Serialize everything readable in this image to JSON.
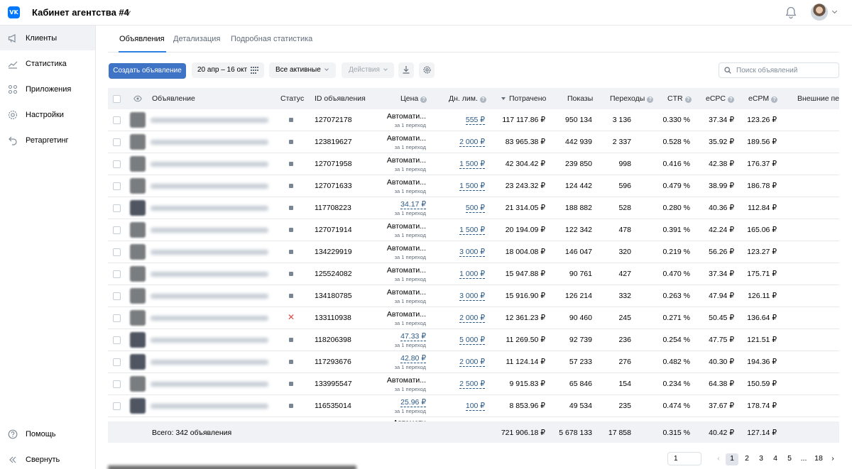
{
  "header": {
    "logo_text": "VK",
    "cabinet_title": "Кабинет агентства #4"
  },
  "sidebar": {
    "items": [
      {
        "label": "Клиенты",
        "icon": "megaphone-icon"
      },
      {
        "label": "Статистика",
        "icon": "chart-line-icon"
      },
      {
        "label": "Приложения",
        "icon": "apps-grid-icon"
      },
      {
        "label": "Настройки",
        "icon": "gear-icon"
      },
      {
        "label": "Ретаргетинг",
        "icon": "retarget-icon"
      }
    ],
    "help": "Помощь",
    "collapse": "Свернуть"
  },
  "tabs": [
    {
      "label": "Объявления",
      "active": true
    },
    {
      "label": "Детализация",
      "active": false
    },
    {
      "label": "Подробная статистика",
      "active": false
    }
  ],
  "toolbar": {
    "create": "Создать объявление",
    "date_range": "20 апр – 16 окт",
    "filter": "Все активные",
    "actions": "Действия",
    "search_placeholder": "Поиск объявлений"
  },
  "table": {
    "columns": {
      "ad": "Объявление",
      "status": "Статус",
      "id": "ID объявления",
      "price": "Цена",
      "limit": "Дн. лим.",
      "spent": "Потрачено",
      "impressions": "Показы",
      "clicks": "Переходы",
      "ctr": "CTR",
      "ecpc": "eCPC",
      "ecpm": "eCPM",
      "external": "Внешние пер"
    },
    "per_click": "за 1 переход",
    "rows": [
      {
        "status": "active",
        "id": "127072178",
        "price": "Автомати...",
        "price_auto": true,
        "limit": "555 ₽",
        "spent": "117 117.86 ₽",
        "impressions": "950 134",
        "clicks": "3 136",
        "ctr": "0.330 %",
        "ecpc": "37.34 ₽",
        "ecpm": "123.26 ₽"
      },
      {
        "status": "active",
        "id": "123819627",
        "price": "Автомати...",
        "price_auto": true,
        "limit": "2 000 ₽",
        "spent": "83 965.38 ₽",
        "impressions": "442 939",
        "clicks": "2 337",
        "ctr": "0.528 %",
        "ecpc": "35.92 ₽",
        "ecpm": "189.56 ₽"
      },
      {
        "status": "active",
        "id": "127071958",
        "price": "Автомати...",
        "price_auto": true,
        "limit": "1 500 ₽",
        "spent": "42 304.42 ₽",
        "impressions": "239 850",
        "clicks": "998",
        "ctr": "0.416 %",
        "ecpc": "42.38 ₽",
        "ecpm": "176.37 ₽"
      },
      {
        "status": "active",
        "id": "127071633",
        "price": "Автомати...",
        "price_auto": true,
        "limit": "1 500 ₽",
        "spent": "23 243.32 ₽",
        "impressions": "124 442",
        "clicks": "596",
        "ctr": "0.479 %",
        "ecpc": "38.99 ₽",
        "ecpm": "186.78 ₽"
      },
      {
        "status": "active",
        "id": "117708223",
        "price": "34.17 ₽",
        "price_auto": false,
        "limit": "500 ₽",
        "spent": "21 314.05 ₽",
        "impressions": "188 882",
        "clicks": "528",
        "ctr": "0.280 %",
        "ecpc": "40.36 ₽",
        "ecpm": "112.84 ₽"
      },
      {
        "status": "active",
        "id": "127071914",
        "price": "Автомати...",
        "price_auto": true,
        "limit": "1 500 ₽",
        "spent": "20 194.09 ₽",
        "impressions": "122 342",
        "clicks": "478",
        "ctr": "0.391 %",
        "ecpc": "42.24 ₽",
        "ecpm": "165.06 ₽"
      },
      {
        "status": "active",
        "id": "134229919",
        "price": "Автомати...",
        "price_auto": true,
        "limit": "3 000 ₽",
        "spent": "18 004.08 ₽",
        "impressions": "146 047",
        "clicks": "320",
        "ctr": "0.219 %",
        "ecpc": "56.26 ₽",
        "ecpm": "123.27 ₽"
      },
      {
        "status": "active",
        "id": "125524082",
        "price": "Автомати...",
        "price_auto": true,
        "limit": "1 000 ₽",
        "spent": "15 947.88 ₽",
        "impressions": "90 761",
        "clicks": "427",
        "ctr": "0.470 %",
        "ecpc": "37.34 ₽",
        "ecpm": "175.71 ₽"
      },
      {
        "status": "active",
        "id": "134180785",
        "price": "Автомати...",
        "price_auto": true,
        "limit": "3 000 ₽",
        "spent": "15 916.90 ₽",
        "impressions": "126 214",
        "clicks": "332",
        "ctr": "0.263 %",
        "ecpc": "47.94 ₽",
        "ecpm": "126.11 ₽"
      },
      {
        "status": "rejected",
        "id": "133110938",
        "price": "Автомати...",
        "price_auto": true,
        "limit": "2 000 ₽",
        "spent": "12 361.23 ₽",
        "impressions": "90 460",
        "clicks": "245",
        "ctr": "0.271 %",
        "ecpc": "50.45 ₽",
        "ecpm": "136.64 ₽"
      },
      {
        "status": "active",
        "id": "118206398",
        "price": "47.33 ₽",
        "price_auto": false,
        "limit": "5 000 ₽",
        "spent": "11 269.50 ₽",
        "impressions": "92 739",
        "clicks": "236",
        "ctr": "0.254 %",
        "ecpc": "47.75 ₽",
        "ecpm": "121.51 ₽"
      },
      {
        "status": "active",
        "id": "117293676",
        "price": "42.80 ₽",
        "price_auto": false,
        "limit": "2 000 ₽",
        "spent": "11 124.14 ₽",
        "impressions": "57 233",
        "clicks": "276",
        "ctr": "0.482 %",
        "ecpc": "40.30 ₽",
        "ecpm": "194.36 ₽"
      },
      {
        "status": "active",
        "id": "133995547",
        "price": "Автомати...",
        "price_auto": true,
        "limit": "2 500 ₽",
        "spent": "9 915.83 ₽",
        "impressions": "65 846",
        "clicks": "154",
        "ctr": "0.234 %",
        "ecpc": "64.38 ₽",
        "ecpm": "150.59 ₽"
      },
      {
        "status": "active",
        "id": "116535014",
        "price": "25.96 ₽",
        "price_auto": false,
        "limit": "100 ₽",
        "spent": "8 853.96 ₽",
        "impressions": "49 534",
        "clicks": "235",
        "ctr": "0.474 %",
        "ecpc": "37.67 ₽",
        "ecpm": "178.74 ₽"
      }
    ],
    "partial_row_price": "Автомати",
    "footer": {
      "total_label": "Всего: 342 объявления",
      "spent": "721 906.18 ₽",
      "impressions": "5 678 133",
      "clicks": "17 858",
      "ctr": "0.315 %",
      "ecpc": "40.42 ₽",
      "ecpm": "127.14 ₽"
    }
  },
  "pagination": {
    "input_value": "1",
    "pages": [
      "1",
      "2",
      "3",
      "4",
      "5",
      "...",
      "18"
    ],
    "current": "1"
  },
  "colors": {
    "accent": "#3f73c6",
    "link": "#2a5885",
    "reject": "#e64646"
  }
}
